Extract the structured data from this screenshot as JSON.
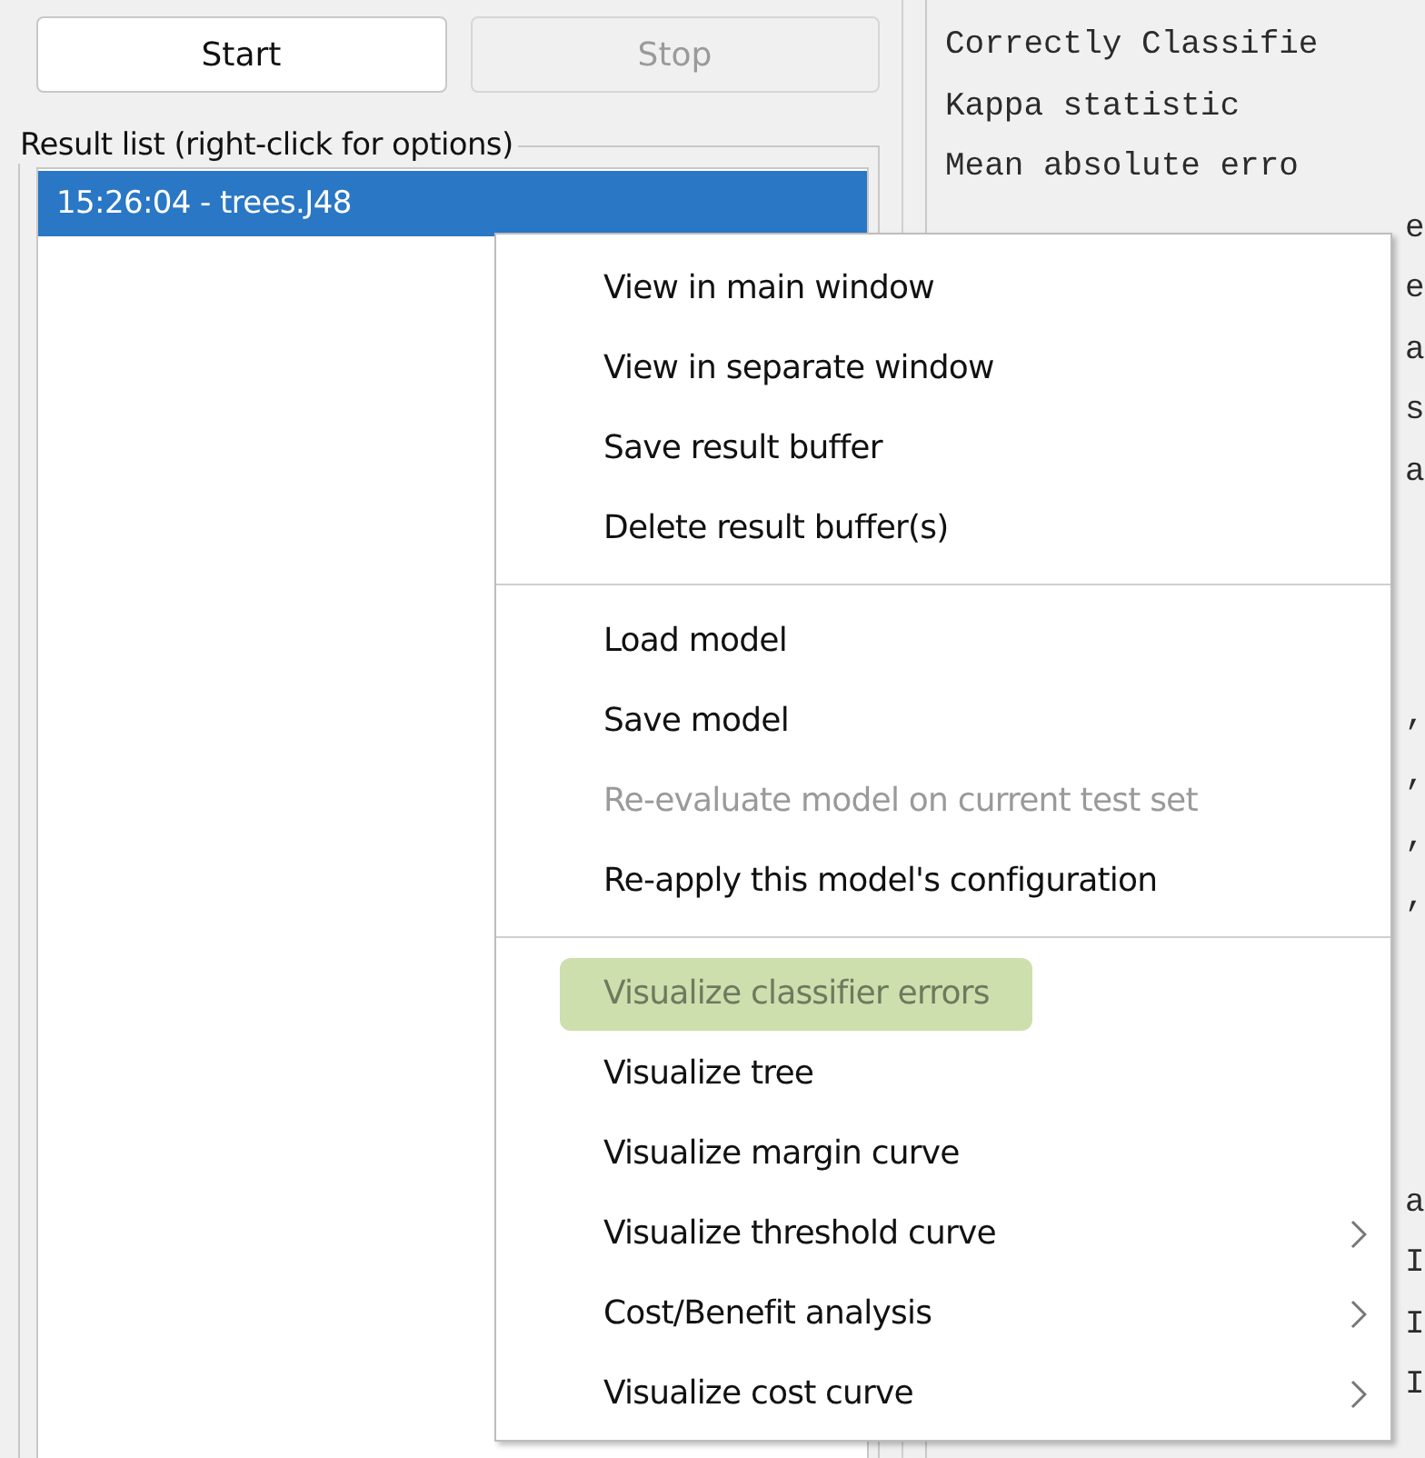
{
  "buttons": [
    {
      "label": "Start",
      "disabled": false
    },
    {
      "label": "Stop",
      "disabled": true
    }
  ],
  "result_list": {
    "title": "Result list (right-click for options)",
    "items": [
      {
        "label": "15:26:04 - trees.J48",
        "selected": true
      }
    ]
  },
  "output": {
    "lines": [
      {
        "kind": "full",
        "text": "Correctly Classifie"
      },
      {
        "kind": "full",
        "text": "Kappa statistic"
      },
      {
        "kind": "full",
        "text": "Mean absolute erro"
      },
      {
        "kind": "tail",
        "text": "e"
      },
      {
        "kind": "tail",
        "text": "e"
      },
      {
        "kind": "tail",
        "text": "a"
      },
      {
        "kind": "tail",
        "text": "s"
      },
      {
        "kind": "tail",
        "text": "a"
      },
      {
        "kind": "blank"
      },
      {
        "kind": "blank"
      },
      {
        "kind": "blank"
      },
      {
        "kind": "tail",
        "text": ","
      },
      {
        "kind": "tail",
        "text": ","
      },
      {
        "kind": "tail",
        "text": ","
      },
      {
        "kind": "tail",
        "text": ","
      },
      {
        "kind": "blank"
      },
      {
        "kind": "blank"
      },
      {
        "kind": "blank"
      },
      {
        "kind": "blank"
      },
      {
        "kind": "tail",
        "text": "a"
      },
      {
        "kind": "tail",
        "text": "I"
      },
      {
        "kind": "tail",
        "text": "I"
      },
      {
        "kind": "tail",
        "text": "I"
      }
    ]
  },
  "context_menu": {
    "groups": [
      [
        {
          "label": "View in main window",
          "disabled": false,
          "selected": false,
          "submenu": false
        },
        {
          "label": "View in separate window",
          "disabled": false,
          "selected": false,
          "submenu": false
        },
        {
          "label": "Save result buffer",
          "disabled": false,
          "selected": false,
          "submenu": false
        },
        {
          "label": "Delete result buffer(s)",
          "disabled": false,
          "selected": false,
          "submenu": false
        }
      ],
      [
        {
          "label": "Load model",
          "disabled": false,
          "selected": false,
          "submenu": false
        },
        {
          "label": "Save model",
          "disabled": false,
          "selected": false,
          "submenu": false
        },
        {
          "label": "Re-evaluate model on current test set",
          "disabled": true,
          "selected": false,
          "submenu": false
        },
        {
          "label": "Re-apply this model's configuration",
          "disabled": false,
          "selected": false,
          "submenu": false
        }
      ],
      [
        {
          "label": "Visualize classifier errors",
          "disabled": true,
          "selected": true,
          "submenu": false
        },
        {
          "label": "Visualize tree",
          "disabled": false,
          "selected": false,
          "submenu": false
        },
        {
          "label": "Visualize margin curve",
          "disabled": false,
          "selected": false,
          "submenu": false
        },
        {
          "label": "Visualize threshold curve",
          "disabled": false,
          "selected": false,
          "submenu": true
        },
        {
          "label": "Cost/Benefit analysis",
          "disabled": false,
          "selected": false,
          "submenu": true
        },
        {
          "label": "Visualize cost curve",
          "disabled": false,
          "selected": false,
          "submenu": true
        }
      ]
    ]
  }
}
